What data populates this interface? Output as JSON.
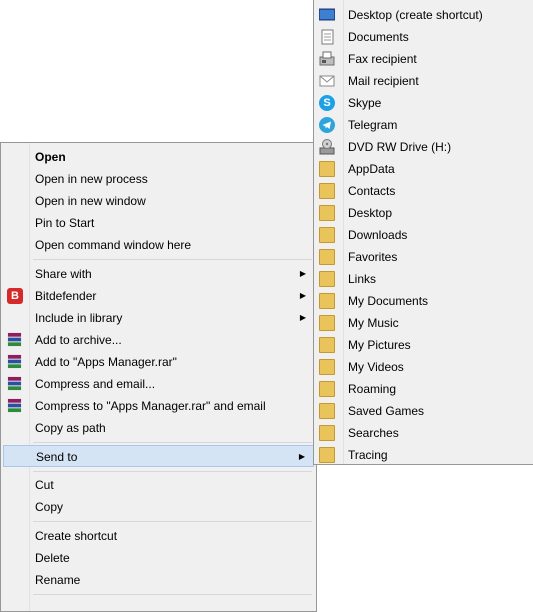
{
  "context_menu": {
    "items": [
      {
        "label": "Open"
      },
      {
        "label": "Open in new process"
      },
      {
        "label": "Open in new window"
      },
      {
        "label": "Pin to Start"
      },
      {
        "label": "Open command window here"
      },
      {
        "label": "Share with"
      },
      {
        "label": "Bitdefender"
      },
      {
        "label": "Include in library"
      },
      {
        "label": "Add to archive..."
      },
      {
        "label": "Add to \"Apps Manager.rar\""
      },
      {
        "label": "Compress and email..."
      },
      {
        "label": "Compress to \"Apps Manager.rar\" and email"
      },
      {
        "label": "Copy as path"
      },
      {
        "label": "Send to"
      },
      {
        "label": "Cut"
      },
      {
        "label": "Copy"
      },
      {
        "label": "Create shortcut"
      },
      {
        "label": "Delete"
      },
      {
        "label": "Rename"
      }
    ],
    "bitdefender_icon_text": "B",
    "submenu_arrow": "▶"
  },
  "send_to_menu": {
    "items": [
      {
        "label": "Desktop (create shortcut)",
        "icon": "desktop-icon"
      },
      {
        "label": "Documents",
        "icon": "documents-icon"
      },
      {
        "label": "Fax recipient",
        "icon": "fax-icon"
      },
      {
        "label": "Mail recipient",
        "icon": "mail-icon"
      },
      {
        "label": "Skype",
        "icon": "skype-icon"
      },
      {
        "label": "Telegram",
        "icon": "telegram-icon"
      },
      {
        "label": "DVD RW Drive (H:)",
        "icon": "dvd-drive-icon"
      },
      {
        "label": "AppData",
        "icon": "folder-icon"
      },
      {
        "label": "Contacts",
        "icon": "folder-icon"
      },
      {
        "label": "Desktop",
        "icon": "folder-icon"
      },
      {
        "label": "Downloads",
        "icon": "folder-icon"
      },
      {
        "label": "Favorites",
        "icon": "folder-icon"
      },
      {
        "label": "Links",
        "icon": "folder-icon"
      },
      {
        "label": "My Documents",
        "icon": "folder-icon"
      },
      {
        "label": "My Music",
        "icon": "folder-icon"
      },
      {
        "label": "My Pictures",
        "icon": "folder-icon"
      },
      {
        "label": "My Videos",
        "icon": "folder-icon"
      },
      {
        "label": "Roaming",
        "icon": "folder-icon"
      },
      {
        "label": "Saved Games",
        "icon": "folder-icon"
      },
      {
        "label": "Searches",
        "icon": "folder-icon"
      },
      {
        "label": "Tracing",
        "icon": "folder-icon"
      }
    ],
    "skype_icon_text": "S"
  },
  "colors": {
    "menu_bg": "#f0f0f0",
    "highlight_bg": "#d5e4f4",
    "highlight_border": "#a9c7ea",
    "bitdefender_red": "#d52a2a",
    "folder_yellow": "#e8c45a"
  }
}
